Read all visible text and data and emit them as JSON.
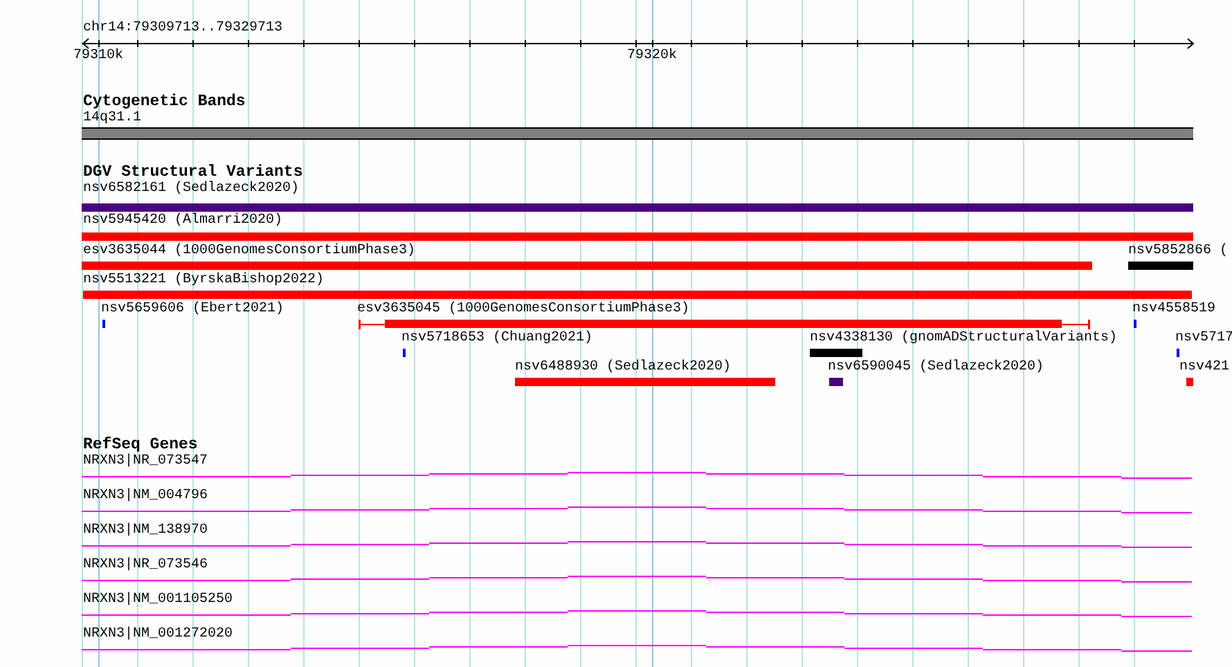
{
  "ruler": {
    "title": "chr14:79309713..79329713",
    "ticks": [
      "79310k",
      "79320k"
    ]
  },
  "cytogenetic_bands": {
    "title": "Cytogenetic Bands",
    "band": "14q31.1"
  },
  "dgv_structural_variants": {
    "title": "DGV Structural Variants",
    "features": [
      {
        "label": "nsv6582161 (Sedlazeck2020)",
        "color": "#4b0082",
        "kind": "bar"
      },
      {
        "label": "nsv5945420 (Almarri2020)",
        "color": "#ff0000",
        "kind": "bar"
      },
      {
        "label": "esv3635044 (1000GenomesConsortiumPhase3)",
        "color": "#ff0000",
        "kind": "bar"
      },
      {
        "label": "nsv5852866 (",
        "color": "#000000",
        "kind": "bar"
      },
      {
        "label": "nsv5513221 (ByrskaBishop2022)",
        "color": "#ff0000",
        "kind": "bar"
      },
      {
        "label": "nsv5659606 (Ebert2021)",
        "color": "#0000ff",
        "kind": "bar"
      },
      {
        "label": "esv3635045 (1000GenomesConsortiumPhase3)",
        "color": "#ff0000",
        "kind": "whisker"
      },
      {
        "label": "nsv4558519",
        "color": "#0000ff",
        "kind": "bar"
      },
      {
        "label": "nsv5718653 (Chuang2021)",
        "color": "#0000ff",
        "kind": "bar"
      },
      {
        "label": "nsv4338130 (gnomADStructuralVariants)",
        "color": "#000000",
        "kind": "bar"
      },
      {
        "label": "nsv5717",
        "color": "#0000ff",
        "kind": "bar"
      },
      {
        "label": "nsv6488930 (Sedlazeck2020)",
        "color": "#ff0000",
        "kind": "bar"
      },
      {
        "label": "nsv6590045 (Sedlazeck2020)",
        "color": "#4b0082",
        "kind": "bar"
      },
      {
        "label": "nsv421",
        "color": "#ff0000",
        "kind": "bar"
      }
    ]
  },
  "refseq_genes": {
    "title": "RefSeq Genes",
    "genes": [
      {
        "label": "NRXN3|NR_073547"
      },
      {
        "label": "NRXN3|NM_004796"
      },
      {
        "label": "NRXN3|NM_138970"
      },
      {
        "label": "NRXN3|NR_073546"
      },
      {
        "label": "NRXN3|NM_001105250"
      },
      {
        "label": "NRXN3|NM_001272020"
      }
    ]
  }
}
